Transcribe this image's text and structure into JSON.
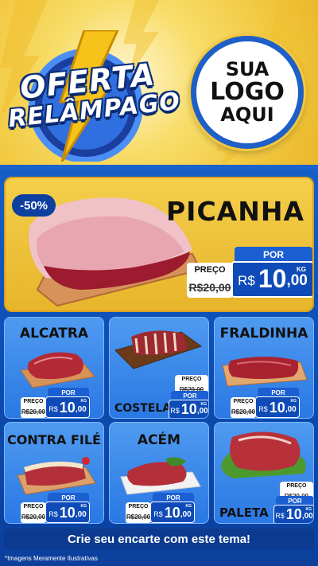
{
  "header": {
    "offer_line1": "OFERTA",
    "offer_line2": "RELÂMPAGO",
    "logo_line1": "SUA",
    "logo_line2": "LOGO",
    "logo_line3": "AQUI"
  },
  "featured": {
    "name": "PICANHA",
    "discount": "-50%",
    "preco_label": "PREÇO",
    "old_price": "R$20,00",
    "por_label": "POR",
    "currency": "R$",
    "price_int": "10",
    "price_dec": ",00",
    "unit": "KG"
  },
  "products": [
    {
      "name": "ALCATRA",
      "preco_label": "PREÇO",
      "old_price": "R$20,00",
      "por_label": "POR",
      "currency": "R$",
      "price_int": "10",
      "price_dec": ",00",
      "unit": "KG"
    },
    {
      "name": "COSTELA",
      "preco_label": "PREÇO",
      "old_price": "R$20,00",
      "por_label": "POR",
      "currency": "R$",
      "price_int": "10",
      "price_dec": ",00",
      "unit": "KG"
    },
    {
      "name": "FRALDINHA",
      "preco_label": "PREÇO",
      "old_price": "R$20,00",
      "por_label": "POR",
      "currency": "R$",
      "price_int": "10",
      "price_dec": ",00",
      "unit": "KG"
    },
    {
      "name": "CONTRA FILÉ",
      "preco_label": "PREÇO",
      "old_price": "R$20,00",
      "por_label": "POR",
      "currency": "R$",
      "price_int": "10",
      "price_dec": ",00",
      "unit": "KG"
    },
    {
      "name": "ACÉM",
      "preco_label": "PREÇO",
      "old_price": "R$20,00",
      "por_label": "POR",
      "currency": "R$",
      "price_int": "10",
      "price_dec": ",00",
      "unit": "KG"
    },
    {
      "name": "PALETA",
      "preco_label": "PREÇO",
      "old_price": "R$20,00",
      "por_label": "POR",
      "currency": "R$",
      "price_int": "10",
      "price_dec": ",00",
      "unit": "KG"
    }
  ],
  "cta": "Crie seu encarte com este tema!",
  "disclaimer": "*Imagens Meramente Ilustrativas",
  "colors": {
    "header_yellow": "#f2c840",
    "featured_yellow": "#e7b52b",
    "card_blue": "#2a78e4",
    "price_blue": "#0e4bb8",
    "dark_navy": "#0b3a90"
  }
}
